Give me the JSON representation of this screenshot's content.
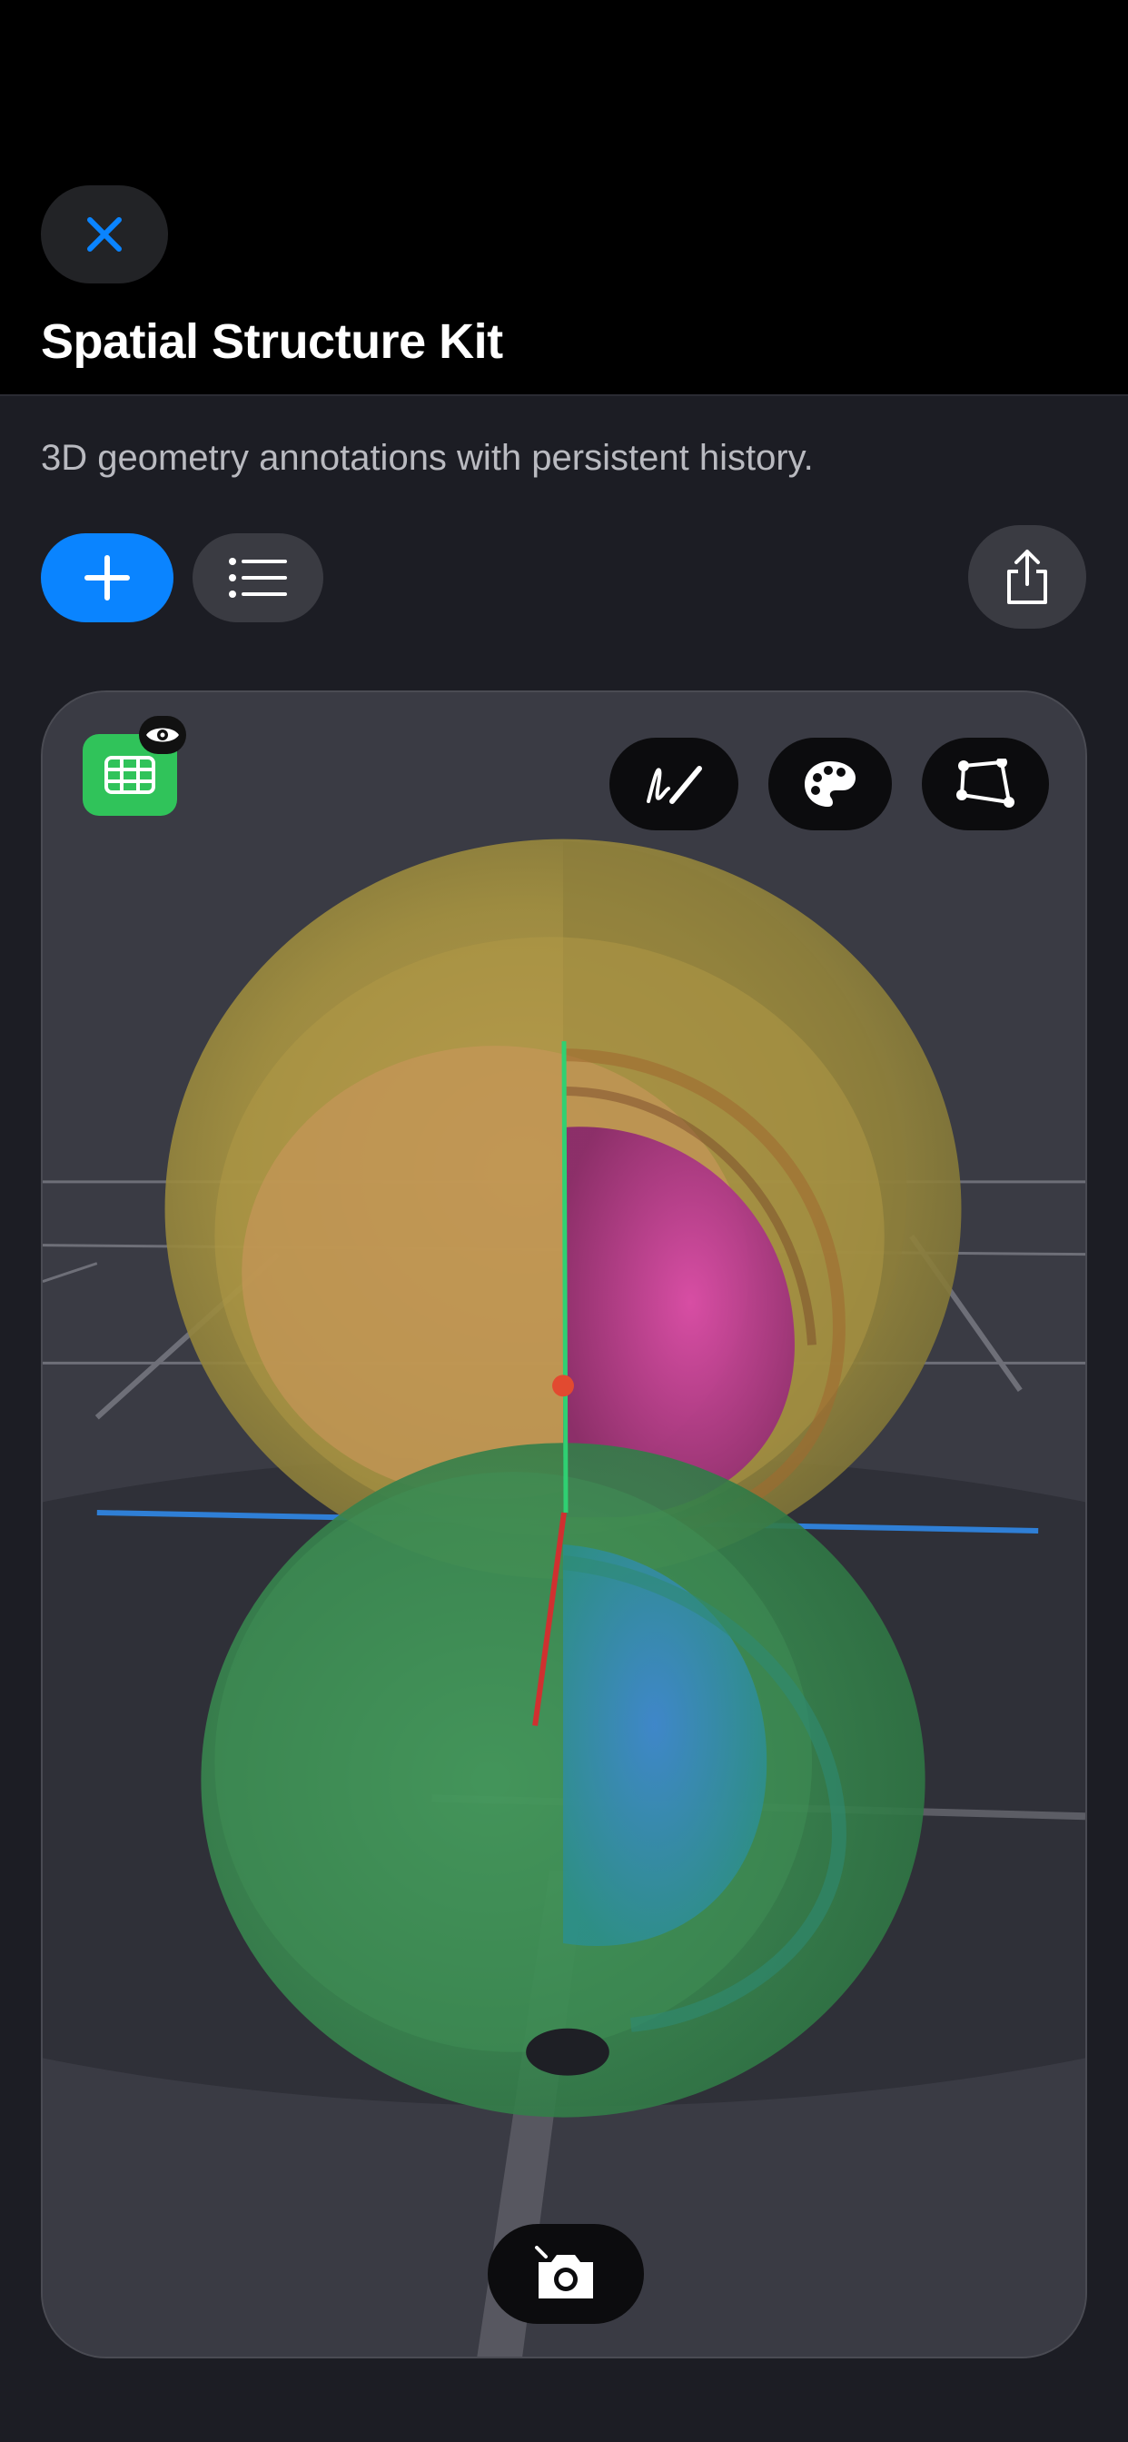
{
  "header": {
    "title": "Spatial Structure Kit",
    "close_icon": "close-icon"
  },
  "subtitle": "3D geometry annotations with persistent history.",
  "toolbar": {
    "add_icon": "plus-icon",
    "list_icon": "list-icon",
    "share_icon": "share-icon"
  },
  "viewport": {
    "grid_toggle_icon": "grid-icon",
    "visibility_icon": "eye-icon",
    "tools": [
      "draw-icon",
      "palette-icon",
      "polygon-icon"
    ],
    "capture_icon": "camera-icon"
  },
  "colors": {
    "accent": "#0a84ff",
    "grid_toggle": "#30c35a",
    "upper_lobe": "#b8a546",
    "inner_upper": "#d2439e",
    "lower_lobe": "#3f9a55",
    "inner_lower": "#3a7fcf"
  }
}
